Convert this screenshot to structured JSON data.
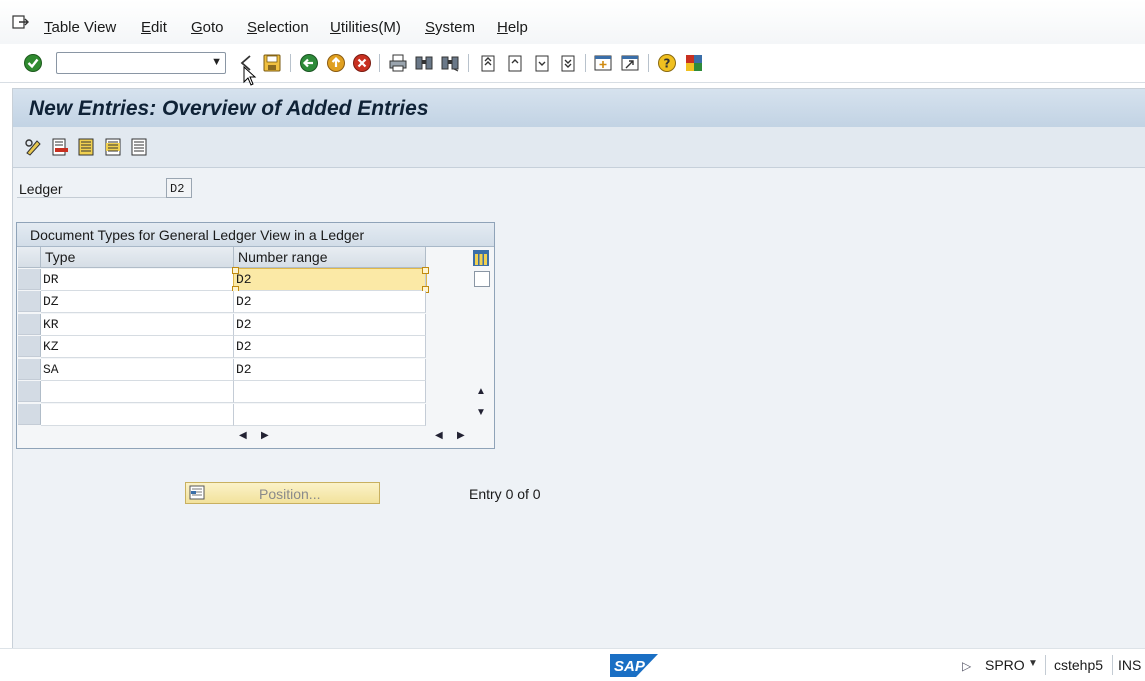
{
  "menu": {
    "items": [
      {
        "label": "Table View",
        "underline": "T",
        "rest": "able View"
      },
      {
        "label": "Edit",
        "underline": "E",
        "rest": "dit"
      },
      {
        "label": "Goto",
        "underline": "G",
        "rest": "oto"
      },
      {
        "label": "Selection",
        "underline": "S",
        "rest": "election"
      },
      {
        "label": "Utilities(M)",
        "underline": "U",
        "rest": "tilities(M)"
      },
      {
        "label": "System",
        "underline": "S",
        "rest": "ystem"
      },
      {
        "label": "Help",
        "underline": "H",
        "rest": "elp"
      }
    ]
  },
  "toolbar": {
    "command_field_value": "",
    "icons": [
      "enter-icon",
      "back-arrow-icon",
      "save-icon",
      "back-icon",
      "exit-icon",
      "cancel-icon",
      "print-icon",
      "find-icon",
      "find-next-icon",
      "first-page-icon",
      "previous-page-icon",
      "next-page-icon",
      "last-page-icon",
      "create-session-icon",
      "create-shortcut-icon",
      "help-icon",
      "customize-layout-icon"
    ]
  },
  "page": {
    "title": "New Entries: Overview of Added Entries"
  },
  "ledger": {
    "label": "Ledger",
    "value": "D2"
  },
  "table": {
    "title": "Document Types for General Ledger View in a Ledger",
    "columns": [
      "Type",
      "Number range"
    ],
    "rows": [
      {
        "type": "DR",
        "number_range": "D2"
      },
      {
        "type": "DZ",
        "number_range": "D2"
      },
      {
        "type": "KR",
        "number_range": "D2"
      },
      {
        "type": "KZ",
        "number_range": "D2"
      },
      {
        "type": "SA",
        "number_range": "D2"
      },
      {
        "type": "",
        "number_range": ""
      },
      {
        "type": "",
        "number_range": ""
      }
    ]
  },
  "position_button": {
    "label": "Position..."
  },
  "entry_info": "Entry 0 of 0",
  "status": {
    "system": "SPRO",
    "host": "cstehp5",
    "mode": "INS",
    "logo_text": "SAP"
  },
  "colors": {
    "title_bar": "#c9d8e7",
    "frame_bg": "#eef2f6",
    "focus_cell": "#fbe9a6",
    "sap_blue": "#1a6fc4"
  }
}
